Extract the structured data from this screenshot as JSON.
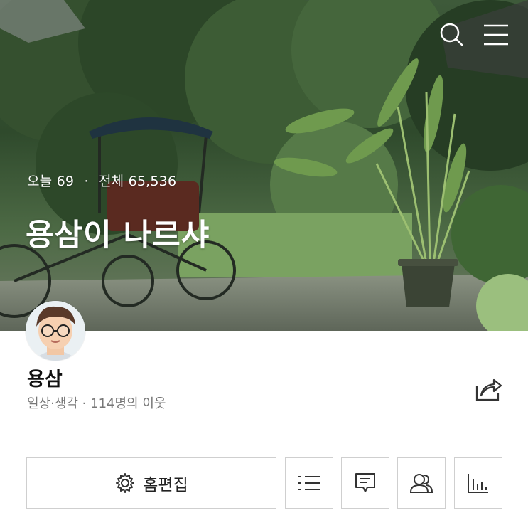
{
  "header": {
    "stats": {
      "today_label": "오늘",
      "today_count": "69",
      "separator": "·",
      "total_label": "전체",
      "total_count": "65,536"
    },
    "blog_title": "용삼이 나르샤",
    "icons": [
      "search-icon",
      "menu-icon"
    ]
  },
  "profile": {
    "nickname": "용삼",
    "meta": "일상·생각 · 114명의 이웃"
  },
  "actions": {
    "edit_home_label": "홈편집",
    "icons": [
      "gear-icon",
      "list-icon",
      "message-icon",
      "neighbors-icon",
      "stats-icon",
      "share-icon"
    ]
  },
  "colors": {
    "text_dark": "#111111",
    "text_muted": "#777777",
    "border": "#cfcfcf"
  }
}
